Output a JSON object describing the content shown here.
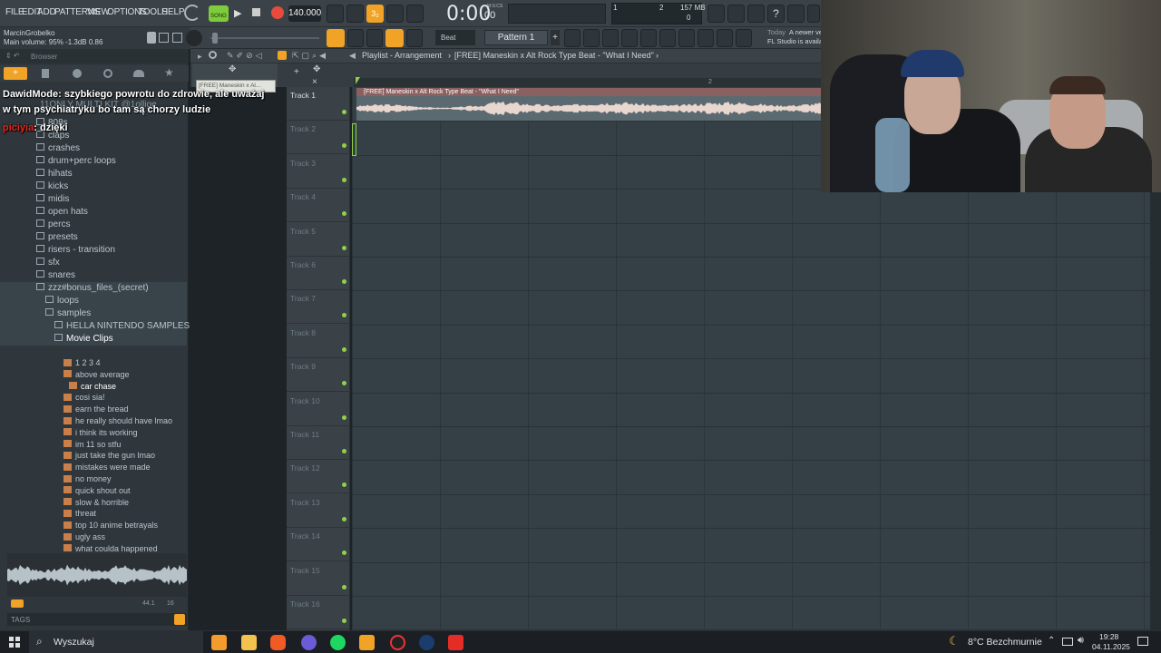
{
  "menu": {
    "items": [
      "FILE",
      "EDIT",
      "ADD",
      "PATTERNS",
      "VIEW",
      "OPTIONS",
      "TOOLS",
      "HELP"
    ]
  },
  "transport": {
    "mode": "SONG",
    "tempo": "140.000",
    "time": "0:00",
    "time_small": "00",
    "time_label": "M:S:CS",
    "step": "3₂",
    "cpu_a": "1",
    "cpu_b": "2",
    "mem": "157 MB",
    "zero": "0"
  },
  "info": {
    "user": "MarcinGrobelko",
    "status": "Main volume: 95%  -1.3dB  0.86",
    "pattern": "Pattern 1",
    "snap": "Beat",
    "news_today": "Today",
    "news_text_1": "A newer ve",
    "news_text_2": "FL Studio is availa"
  },
  "browser": {
    "title": "Browser",
    "items": [
      {
        "label": "808s",
        "type": "folder",
        "indent": 40
      },
      {
        "label": "claps",
        "type": "folder",
        "indent": 40
      },
      {
        "label": "crashes",
        "type": "folder",
        "indent": 40
      },
      {
        "label": "drum+perc loops",
        "type": "folder",
        "indent": 40
      },
      {
        "label": "hihats",
        "type": "folder",
        "indent": 40
      },
      {
        "label": "kicks",
        "type": "folder",
        "indent": 40
      },
      {
        "label": "midis",
        "type": "folder",
        "indent": 40
      },
      {
        "label": "open hats",
        "type": "folder",
        "indent": 40
      },
      {
        "label": "percs",
        "type": "folder",
        "indent": 40
      },
      {
        "label": "presets",
        "type": "folder",
        "indent": 40
      },
      {
        "label": "risers - transition",
        "type": "folder",
        "indent": 40
      },
      {
        "label": "sfx",
        "type": "folder",
        "indent": 40
      },
      {
        "label": "snares",
        "type": "folder",
        "indent": 40
      },
      {
        "label": "zzz#bonus_files_(secret)",
        "type": "folder",
        "indent": 40
      },
      {
        "label": "loops",
        "type": "folder",
        "indent": 50
      },
      {
        "label": "samples",
        "type": "folder",
        "indent": 50
      },
      {
        "label": "HELLA NINTENDO SAMPLES",
        "type": "folder",
        "indent": 60
      },
      {
        "label": "Movie Clips",
        "type": "folder",
        "indent": 60
      },
      {
        "label": "1 2 3 4",
        "type": "file",
        "indent": 70
      },
      {
        "label": "above average",
        "type": "file",
        "indent": 70
      },
      {
        "label": "car chase",
        "type": "file",
        "indent": 76
      },
      {
        "label": "cosi sia!",
        "type": "file",
        "indent": 70
      },
      {
        "label": "earn the bread",
        "type": "file",
        "indent": 70
      },
      {
        "label": "he really should have lmao",
        "type": "file",
        "indent": 70
      },
      {
        "label": "i think its working",
        "type": "file",
        "indent": 70
      },
      {
        "label": "im 11 so stfu",
        "type": "file",
        "indent": 70
      },
      {
        "label": "just take the gun lmao",
        "type": "file",
        "indent": 70
      },
      {
        "label": "mistakes were made",
        "type": "file",
        "indent": 70
      },
      {
        "label": "no money",
        "type": "file",
        "indent": 70
      },
      {
        "label": "quick shout out",
        "type": "file",
        "indent": 70
      },
      {
        "label": "slow & horrible",
        "type": "file",
        "indent": 70
      },
      {
        "label": "threat",
        "type": "file",
        "indent": 70
      },
      {
        "label": "top 10 anime betrayals",
        "type": "file",
        "indent": 70
      },
      {
        "label": "ugly ass",
        "type": "file",
        "indent": 70
      },
      {
        "label": "what coulda happened",
        "type": "file",
        "indent": 70
      }
    ],
    "hidden_item": "11ONLY MULTI KIT @1ollige",
    "sample_rate": "44.1",
    "sample_bits": "16",
    "tags": "TAGS"
  },
  "playlist": {
    "breadcrumb": "Playlist - Arrangement",
    "project": "[FREE] Maneskin x Alt Rock Type Beat - \"What I Need\"",
    "clip_label": "[FREE] Maneskin x Alt Rock Type Beat - \"What I Need\"",
    "clip_short": "[FREE] Maneskin x Al...",
    "bar_marker": "2",
    "tracks": [
      "Track 1",
      "Track 2",
      "Track 3",
      "Track 4",
      "Track 5",
      "Track 6",
      "Track 7",
      "Track 8",
      "Track 9",
      "Track 10",
      "Track 11",
      "Track 12",
      "Track 13",
      "Track 14",
      "Track 15",
      "Track 16"
    ]
  },
  "chat": {
    "l1_user": "DawidMode",
    "l1_text": ": szybkiego powrotu do zdrowie, ale uważaj",
    "l2_text": "w tym psychiatryku bo tam są chorzy ludzie",
    "l3_user": "piciyia",
    "l3_text": ": dzięki"
  },
  "taskbar": {
    "search": "Wyszukaj",
    "weather": "8°C  Bezchmurnie",
    "time": "19:28",
    "date": "04.11.2025"
  },
  "colors": {
    "accent": "#f0a326",
    "green": "#8fd14a",
    "bg": "#344045"
  }
}
